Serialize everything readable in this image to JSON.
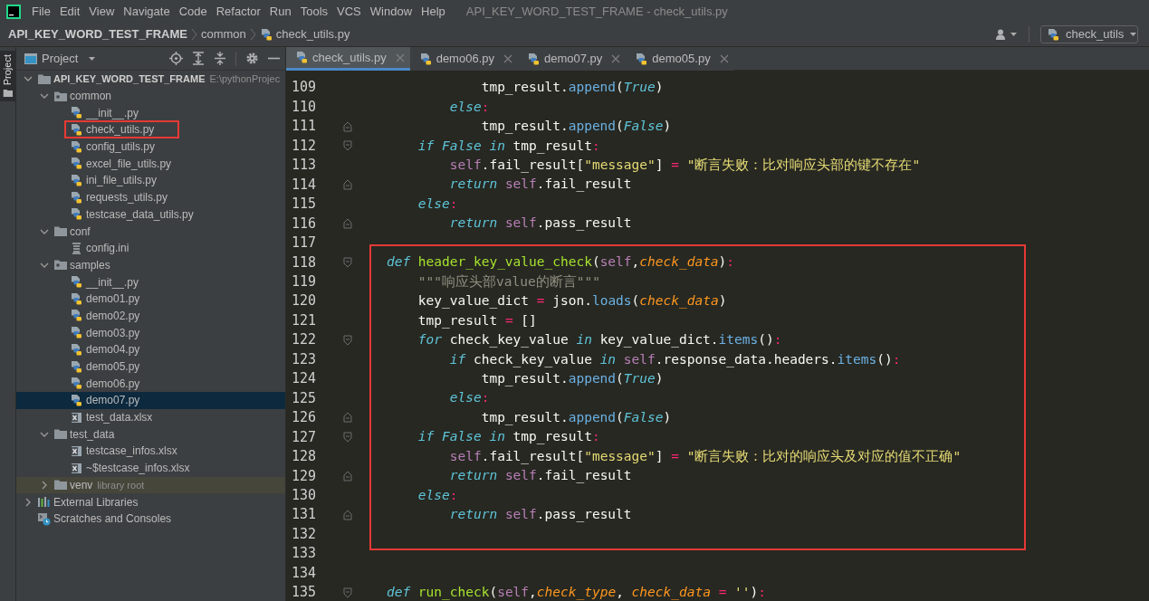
{
  "window": {
    "title": "API_KEY_WORD_TEST_FRAME - check_utils.py"
  },
  "menu": [
    "File",
    "Edit",
    "View",
    "Navigate",
    "Code",
    "Refactor",
    "Run",
    "Tools",
    "VCS",
    "Window",
    "Help"
  ],
  "breadcrumbs": [
    {
      "label": "API_KEY_WORD_TEST_FRAME",
      "kind": "project"
    },
    {
      "label": "common",
      "kind": "folder"
    },
    {
      "label": "check_utils.py",
      "kind": "python"
    }
  ],
  "run_config": {
    "label": "check_utils"
  },
  "tool_strip": {
    "label": "Project",
    "selected": true
  },
  "project_panel": {
    "title": "Project"
  },
  "tree": [
    {
      "label": "API_KEY_WORD_TEST_FRAME",
      "hint": "E:\\pythonProjec",
      "kind": "folder",
      "expanded": true,
      "selected": false,
      "children": [
        {
          "label": "common",
          "kind": "package",
          "expanded": true,
          "selected": false,
          "children": [
            {
              "label": "__init__.py",
              "kind": "python",
              "selected": false
            },
            {
              "label": "check_utils.py",
              "kind": "python",
              "selected": false,
              "outlined": true
            },
            {
              "label": "config_utils.py",
              "kind": "python",
              "selected": false
            },
            {
              "label": "excel_file_utils.py",
              "kind": "python",
              "selected": false
            },
            {
              "label": "ini_file_utils.py",
              "kind": "python",
              "selected": false
            },
            {
              "label": "requests_utils.py",
              "kind": "python",
              "selected": false
            },
            {
              "label": "testcase_data_utils.py",
              "kind": "python",
              "selected": false
            }
          ]
        },
        {
          "label": "conf",
          "kind": "folder",
          "expanded": true,
          "selected": false,
          "children": [
            {
              "label": "config.ini",
              "kind": "ini",
              "selected": false
            }
          ]
        },
        {
          "label": "samples",
          "kind": "package",
          "expanded": true,
          "selected": false,
          "children": [
            {
              "label": "__init__.py",
              "kind": "python",
              "selected": false
            },
            {
              "label": "demo01.py",
              "kind": "python",
              "selected": false
            },
            {
              "label": "demo02.py",
              "kind": "python",
              "selected": false
            },
            {
              "label": "demo03.py",
              "kind": "python",
              "selected": false
            },
            {
              "label": "demo04.py",
              "kind": "python",
              "selected": false
            },
            {
              "label": "demo05.py",
              "kind": "python",
              "selected": false
            },
            {
              "label": "demo06.py",
              "kind": "python",
              "selected": false
            },
            {
              "label": "demo07.py",
              "kind": "python",
              "selected": true
            },
            {
              "label": "test_data.xlsx",
              "kind": "excel",
              "selected": false
            }
          ]
        },
        {
          "label": "test_data",
          "kind": "folder",
          "expanded": true,
          "selected": false,
          "children": [
            {
              "label": "testcase_infos.xlsx",
              "kind": "excel",
              "selected": false
            },
            {
              "label": "~$testcase_infos.xlsx",
              "kind": "excel",
              "selected": false
            }
          ]
        },
        {
          "label": "venv",
          "hint": "library root",
          "kind": "folder",
          "expanded": false,
          "selected": false,
          "tinted": true
        }
      ]
    },
    {
      "label": "External Libraries",
      "kind": "libraries",
      "expanded": false,
      "selected": false
    },
    {
      "label": "Scratches and Consoles",
      "kind": "scratches",
      "selected": false
    }
  ],
  "editor": {
    "tabs": [
      {
        "label": "check_utils.py",
        "selected": true
      },
      {
        "label": "demo06.py",
        "selected": false
      },
      {
        "label": "demo07.py",
        "selected": false
      },
      {
        "label": "demo05.py",
        "selected": false
      }
    ],
    "blocks": [
      {
        "boxed": false,
        "lines": [
          {
            "number": "109",
            "tokens": [
              {
                "kind": "plain",
                "text": "                tmp_result."
              },
              {
                "kind": "method",
                "text": "append"
              },
              {
                "kind": "plain",
                "text": "("
              },
              {
                "kind": "kw",
                "text": "True"
              },
              {
                "kind": "plain",
                "text": ")"
              }
            ]
          },
          {
            "number": "110",
            "tokens": [
              {
                "kind": "kw",
                "text": "            else"
              },
              {
                "kind": "op",
                "text": ":"
              }
            ]
          },
          {
            "number": "111",
            "fold_close": true,
            "tokens": [
              {
                "kind": "plain",
                "text": "                tmp_result."
              },
              {
                "kind": "method",
                "text": "append"
              },
              {
                "kind": "plain",
                "text": "("
              },
              {
                "kind": "kw",
                "text": "False"
              },
              {
                "kind": "plain",
                "text": ")"
              }
            ]
          },
          {
            "number": "112",
            "fold_open": true,
            "tokens": [
              {
                "kind": "kw",
                "text": "        if False in"
              },
              {
                "kind": "plain",
                "text": " tmp_result"
              },
              {
                "kind": "op",
                "text": ":"
              }
            ]
          },
          {
            "number": "113",
            "tokens": [
              {
                "kind": "self",
                "text": "            self"
              },
              {
                "kind": "plain",
                "text": ".fail_result["
              },
              {
                "kind": "str",
                "text": "\"message\""
              },
              {
                "kind": "plain",
                "text": "] "
              },
              {
                "kind": "op",
                "text": "="
              },
              {
                "kind": "str",
                "text": " \"断言失败：比对响应头部的键不存在\""
              }
            ]
          },
          {
            "number": "114",
            "fold_close": true,
            "tokens": [
              {
                "kind": "kw",
                "text": "            return "
              },
              {
                "kind": "self",
                "text": "self"
              },
              {
                "kind": "plain",
                "text": ".fail_result"
              }
            ]
          },
          {
            "number": "115",
            "tokens": [
              {
                "kind": "kw",
                "text": "        else"
              },
              {
                "kind": "op",
                "text": ":"
              }
            ]
          },
          {
            "number": "116",
            "fold_close": true,
            "tokens": [
              {
                "kind": "kw",
                "text": "            return "
              },
              {
                "kind": "self",
                "text": "self"
              },
              {
                "kind": "plain",
                "text": ".pass_result"
              }
            ]
          },
          {
            "number": "117"
          }
        ]
      },
      {
        "boxed": true,
        "lines": [
          {
            "number": "118",
            "fold_open": true,
            "tokens": [
              {
                "kind": "kw",
                "text": "    def "
              },
              {
                "kind": "fn",
                "text": "header_key_value_check"
              },
              {
                "kind": "plain",
                "text": "("
              },
              {
                "kind": "self",
                "text": "self"
              },
              {
                "kind": "plain",
                "text": ","
              },
              {
                "kind": "param",
                "text": "check_data"
              },
              {
                "kind": "plain",
                "text": ")"
              },
              {
                "kind": "op",
                "text": ":"
              }
            ]
          },
          {
            "number": "119",
            "tokens": [
              {
                "kind": "comment",
                "text": "        \"\"\"响应头部value的断言\"\"\""
              }
            ]
          },
          {
            "number": "120",
            "tokens": [
              {
                "kind": "plain",
                "text": "        key_value_dict "
              },
              {
                "kind": "op",
                "text": "="
              },
              {
                "kind": "plain",
                "text": " json."
              },
              {
                "kind": "method",
                "text": "loads"
              },
              {
                "kind": "plain",
                "text": "("
              },
              {
                "kind": "param",
                "text": "check_data"
              },
              {
                "kind": "plain",
                "text": ")"
              }
            ]
          },
          {
            "number": "121",
            "tokens": [
              {
                "kind": "plain",
                "text": "        tmp_result "
              },
              {
                "kind": "op",
                "text": "="
              },
              {
                "kind": "plain",
                "text": " []"
              }
            ]
          },
          {
            "number": "122",
            "fold_open": true,
            "tokens": [
              {
                "kind": "kw",
                "text": "        for"
              },
              {
                "kind": "plain",
                "text": " check_key_value "
              },
              {
                "kind": "kw",
                "text": "in"
              },
              {
                "kind": "plain",
                "text": " key_value_dict."
              },
              {
                "kind": "method",
                "text": "items"
              },
              {
                "kind": "plain",
                "text": "()"
              },
              {
                "kind": "op",
                "text": ":"
              }
            ]
          },
          {
            "number": "123",
            "tokens": [
              {
                "kind": "kw",
                "text": "            if"
              },
              {
                "kind": "plain",
                "text": " check_key_value "
              },
              {
                "kind": "kw",
                "text": "in "
              },
              {
                "kind": "self",
                "text": "self"
              },
              {
                "kind": "plain",
                "text": ".response_data.headers."
              },
              {
                "kind": "method",
                "text": "items"
              },
              {
                "kind": "plain",
                "text": "()"
              },
              {
                "kind": "op",
                "text": ":"
              }
            ]
          },
          {
            "number": "124",
            "tokens": [
              {
                "kind": "plain",
                "text": "                tmp_result."
              },
              {
                "kind": "method",
                "text": "append"
              },
              {
                "kind": "plain",
                "text": "("
              },
              {
                "kind": "kw",
                "text": "True"
              },
              {
                "kind": "plain",
                "text": ")"
              }
            ]
          },
          {
            "number": "125",
            "tokens": [
              {
                "kind": "kw",
                "text": "            else"
              },
              {
                "kind": "op",
                "text": ":"
              }
            ]
          },
          {
            "number": "126",
            "fold_close": true,
            "tokens": [
              {
                "kind": "plain",
                "text": "                tmp_result."
              },
              {
                "kind": "method",
                "text": "append"
              },
              {
                "kind": "plain",
                "text": "("
              },
              {
                "kind": "kw",
                "text": "False"
              },
              {
                "kind": "plain",
                "text": ")"
              }
            ]
          },
          {
            "number": "127",
            "fold_open": true,
            "tokens": [
              {
                "kind": "kw",
                "text": "        if False in"
              },
              {
                "kind": "plain",
                "text": " tmp_result"
              },
              {
                "kind": "op",
                "text": ":"
              }
            ]
          },
          {
            "number": "128",
            "tokens": [
              {
                "kind": "self",
                "text": "            self"
              },
              {
                "kind": "plain",
                "text": ".fail_result["
              },
              {
                "kind": "str",
                "text": "\"message\""
              },
              {
                "kind": "plain",
                "text": "] "
              },
              {
                "kind": "op",
                "text": "="
              },
              {
                "kind": "str",
                "text": " \"断言失败：比对的响应头及对应的值不正确\""
              }
            ]
          },
          {
            "number": "129",
            "fold_close": true,
            "tokens": [
              {
                "kind": "kw",
                "text": "            return "
              },
              {
                "kind": "self",
                "text": "self"
              },
              {
                "kind": "plain",
                "text": ".fail_result"
              }
            ]
          },
          {
            "number": "130",
            "tokens": [
              {
                "kind": "kw",
                "text": "        else"
              },
              {
                "kind": "op",
                "text": ":"
              }
            ]
          },
          {
            "number": "131",
            "fold_close": true,
            "tokens": [
              {
                "kind": "kw",
                "text": "            return "
              },
              {
                "kind": "self",
                "text": "self"
              },
              {
                "kind": "plain",
                "text": ".pass_result"
              }
            ]
          },
          {
            "number": "132"
          }
        ]
      },
      {
        "boxed": false,
        "lines": [
          {
            "number": "133"
          },
          {
            "number": "134"
          },
          {
            "number": "135",
            "fold_open": true,
            "tokens": [
              {
                "kind": "kw",
                "text": "    def "
              },
              {
                "kind": "fn",
                "text": "run_check"
              },
              {
                "kind": "plain",
                "text": "("
              },
              {
                "kind": "self",
                "text": "self"
              },
              {
                "kind": "plain",
                "text": ","
              },
              {
                "kind": "param",
                "text": "check_type"
              },
              {
                "kind": "plain",
                "text": ", "
              },
              {
                "kind": "param",
                "text": "check_data"
              },
              {
                "kind": "op",
                "text": " ="
              },
              {
                "kind": "str",
                "text": " ''"
              },
              {
                "kind": "plain",
                "text": ")"
              },
              {
                "kind": "op",
                "text": ":"
              }
            ]
          }
        ]
      }
    ]
  }
}
